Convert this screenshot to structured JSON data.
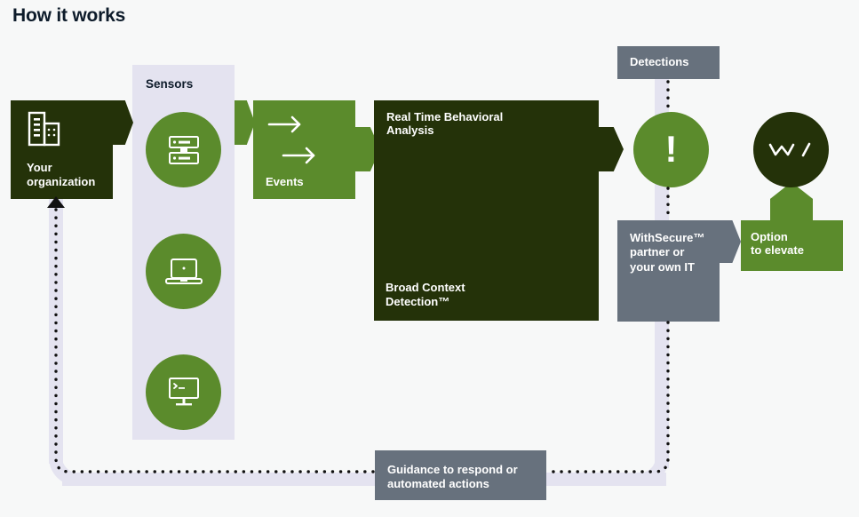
{
  "page": {
    "title": "How it works",
    "background": "#f7f8f8"
  },
  "colors": {
    "dark_green": "#243209",
    "green": "#5b8b2c",
    "gray": "#67717d",
    "lavender": "#e4e3f0",
    "white": "#ffffff",
    "title_text": "#0d1b2a"
  },
  "nodes": {
    "organization": {
      "label": "Your\norganization",
      "line1": "Your",
      "line2": "organization",
      "icon": "office-building-icon",
      "color": "#243209"
    },
    "sensors": {
      "label": "Sensors",
      "color": "#e4e3f0",
      "items": [
        {
          "icon": "server-icon",
          "name": "server-sensor"
        },
        {
          "icon": "laptop-icon",
          "name": "laptop-sensor"
        },
        {
          "icon": "desktop-terminal-icon",
          "name": "desktop-sensor"
        }
      ]
    },
    "events": {
      "label": "Events",
      "icon": "double-arrow-right-icon",
      "color": "#5b8b2c"
    },
    "analysis": {
      "top_line1": "Real Time Behavioral",
      "top_line2": "Analysis",
      "bottom_line1": "Broad Context",
      "bottom_line2": "Detection™",
      "color": "#243209"
    },
    "detections": {
      "label": "Detections",
      "color": "#67717d"
    },
    "alert": {
      "glyph": "!",
      "icon": "exclamation-icon",
      "color": "#5b8b2c"
    },
    "partner": {
      "line1": "WithSecure™",
      "line2": "partner or",
      "line3": "your own IT",
      "color": "#67717d"
    },
    "elevate": {
      "line1": "Option",
      "line2": "to elevate",
      "color": "#5b8b2c"
    },
    "withsecure_logo": {
      "glyph": "W /",
      "icon": "withsecure-logo-icon",
      "color": "#243209"
    },
    "guidance": {
      "line1": "Guidance to respond or",
      "line2": "automated actions",
      "color": "#67717d"
    }
  },
  "connectors": [
    {
      "name": "org-to-sensors",
      "style": "solid-chevron",
      "color": "#243209"
    },
    {
      "name": "sensors-to-events",
      "style": "solid-chevron",
      "color": "#5b8b2c"
    },
    {
      "name": "events-to-analysis",
      "style": "solid-chevron",
      "color": "#5b8b2c"
    },
    {
      "name": "analysis-to-alert",
      "style": "solid-chevron",
      "color": "#243209"
    },
    {
      "name": "detections-to-alert",
      "style": "dotted",
      "color": "#111111"
    },
    {
      "name": "alert-to-partner",
      "style": "dotted",
      "color": "#111111"
    },
    {
      "name": "partner-to-elevate",
      "style": "solid-chevron",
      "color": "#67717d"
    },
    {
      "name": "elevate-to-withsecure",
      "style": "solid-arrow-up",
      "color": "#5b8b2c"
    },
    {
      "name": "partner-to-guidance-feedback",
      "style": "dotted-track",
      "color": "#111111"
    },
    {
      "name": "guidance-to-organization-feedback",
      "style": "dotted-track-arrow",
      "color": "#111111"
    }
  ]
}
